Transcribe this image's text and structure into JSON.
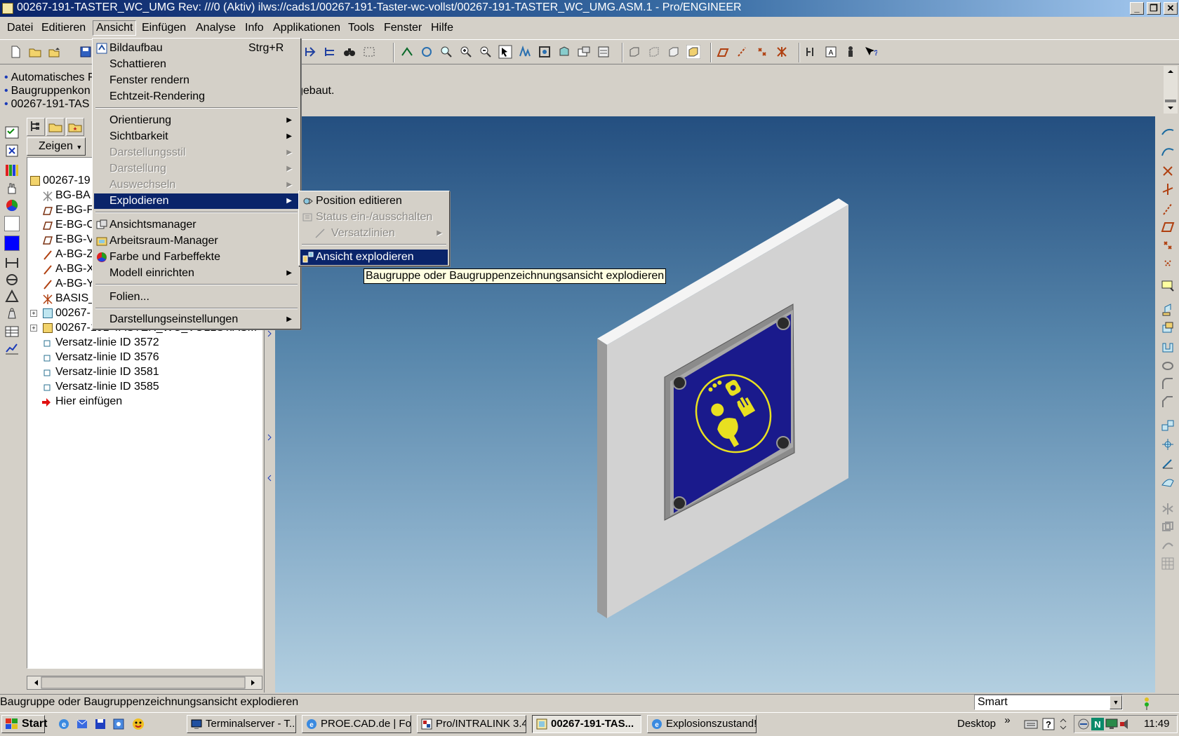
{
  "window": {
    "title": "00267-191-TASTER_WC_UMG Rev: ///0 (Aktiv) ilws://cads1/00267-191-Taster-wc-vollst/00267-191-TASTER_WC_UMG.ASM.1 - Pro/ENGINEER",
    "min": "_",
    "max": "❐",
    "close": "✕"
  },
  "menubar": [
    "Datei",
    "Editieren",
    "Ansicht",
    "Einfügen",
    "Analyse",
    "Info",
    "Applikationen",
    "Tools",
    "Fenster",
    "Hilfe"
  ],
  "messages": [
    "Automatisches F",
    "Baugruppenkon",
    "00267-191-TAS"
  ],
  "message_tail": "gebaut.",
  "tree": {
    "show_button": "Zeigen",
    "rows": [
      {
        "label": "00267-19",
        "icon": "assembly-icon"
      },
      {
        "label": "BG-BA",
        "icon": "csys-icon"
      },
      {
        "label": "E-BG-F",
        "icon": "datum-plane-icon"
      },
      {
        "label": "E-BG-C",
        "icon": "datum-plane-icon"
      },
      {
        "label": "E-BG-V",
        "icon": "datum-plane-icon"
      },
      {
        "label": "A-BG-Z",
        "icon": "datum-axis-icon"
      },
      {
        "label": "A-BG-X",
        "icon": "datum-axis-icon"
      },
      {
        "label": "A-BG-Y",
        "icon": "datum-axis-icon"
      },
      {
        "label": "BASIS_",
        "icon": "csys-icon"
      },
      {
        "label": "00267-",
        "icon": "part-icon"
      },
      {
        "label": "00267-191-TASTER_WC_VOLLST.ASM",
        "icon": "assembly-icon"
      },
      {
        "label": "Versatz-linie ID 3572",
        "icon": "offset-line-icon"
      },
      {
        "label": "Versatz-linie ID 3576",
        "icon": "offset-line-icon"
      },
      {
        "label": "Versatz-linie ID 3581",
        "icon": "offset-line-icon"
      },
      {
        "label": "Versatz-linie ID 3585",
        "icon": "offset-line-icon"
      },
      {
        "label": "Hier einfügen",
        "icon": "insert-here-icon"
      }
    ]
  },
  "ansicht_menu": {
    "bildaufbau": "Bildaufbau",
    "bildaufbau_shortcut": "Strg+R",
    "schattieren": "Schattieren",
    "fenster_rendern": "Fenster rendern",
    "echtzeit": "Echtzeit-Rendering",
    "orientierung": "Orientierung",
    "sichtbarkeit": "Sichtbarkeit",
    "darstellungsstil": "Darstellungsstil",
    "darstellung": "Darstellung",
    "auswechseln": "Auswechseln",
    "explodieren": "Explodieren",
    "ansichtsmanager": "Ansichtsmanager",
    "arbeitsraum": "Arbeitsraum-Manager",
    "farbe": "Farbe und Farbeffekte",
    "modell": "Modell einrichten",
    "folien": "Folien...",
    "darstellungseinstellungen": "Darstellungseinstellungen"
  },
  "explode_menu": {
    "position": "Position editieren",
    "status": "Status ein-/ausschalten",
    "versatz": "Versatzlinien",
    "ansicht": "Ansicht explodieren"
  },
  "tooltip": "Baugruppe oder Baugruppenzeichnungsansicht explodieren",
  "status": {
    "text": "Baugruppe oder Baugruppenzeichnungsansicht explodieren",
    "filter": "Smart"
  },
  "taskbar": {
    "start": "Start",
    "tasks": [
      {
        "label": "Terminalserver - T...",
        "active": false
      },
      {
        "label": "PROE.CAD.de | Fo...",
        "active": false
      },
      {
        "label": "Pro/INTRALINK 3.4",
        "active": false
      },
      {
        "label": "00267-191-TAS...",
        "active": true
      },
      {
        "label": "Explosionszustand!...",
        "active": false
      }
    ],
    "desktop": "Desktop",
    "more": "»",
    "clock": "11:49"
  },
  "colors": {
    "title_active": "#0a246a",
    "menu_highlight": "#0a246a",
    "model_face": "#1a1a8c",
    "model_symbol": "#e8e020",
    "tooltip_bg": "#ffffe1"
  }
}
